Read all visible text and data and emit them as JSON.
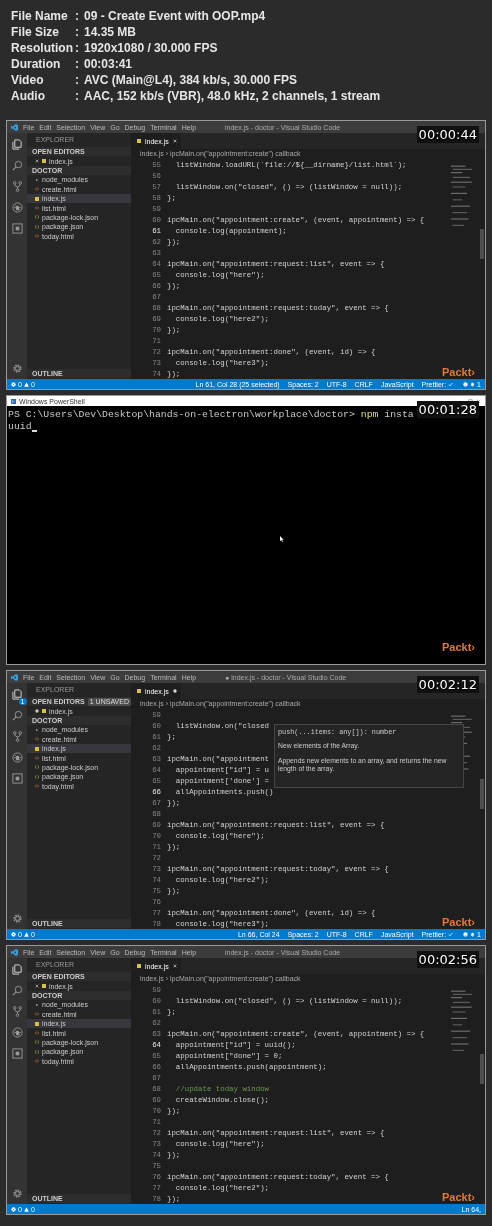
{
  "info": [
    {
      "label": "File Name",
      "sep": ":",
      "value": "09 - Create Event with OOP.mp4"
    },
    {
      "label": "File Size",
      "sep": ":",
      "value": "14.35 MB"
    },
    {
      "label": "Resolution",
      "sep": ":",
      "value": "1920x1080 / 30.000 FPS"
    },
    {
      "label": "Duration",
      "sep": ":",
      "value": "00:03:41"
    },
    {
      "label": "Video",
      "sep": ":",
      "value": "AVC (Main@L4), 384 kb/s, 30.000 FPS"
    },
    {
      "label": "Audio",
      "sep": ":",
      "value": "AAC, 152 kb/s (VBR), 48.0 kHz, 2 channels, 1 stream"
    }
  ],
  "frames": [
    {
      "kind": "vscode",
      "timestamp": "00:00:44",
      "logo": "Packt›",
      "menu": [
        "File",
        "Edit",
        "Selection",
        "View",
        "Go",
        "Debug",
        "Terminal",
        "Help"
      ],
      "title": "index.js - doctor - Visual Studio Code",
      "unsaved": false,
      "sidebar_title": "EXPLORER",
      "open_editors": "OPEN EDITORS",
      "open_file": "index.js",
      "folder": "DOCTOR",
      "outline": "OUTLINE",
      "files": [
        {
          "name": "node_modules",
          "kind": "folder",
          "selected": false
        },
        {
          "name": "create.html",
          "kind": "html",
          "selected": false
        },
        {
          "name": "index.js",
          "kind": "js",
          "selected": true
        },
        {
          "name": "list.html",
          "kind": "html",
          "selected": false
        },
        {
          "name": "package-lock.json",
          "kind": "json",
          "selected": false
        },
        {
          "name": "package.json",
          "kind": "json",
          "selected": false
        },
        {
          "name": "today.html",
          "kind": "html",
          "selected": false
        }
      ],
      "tab": "index.js",
      "breadcrumb": "index.js › ipcMain.on(\"appointment:create\") callback",
      "lines": [
        {
          "num": "55",
          "code": "  listWindow.loadURL(`file://${__dirname}/list.html`);",
          "kind": "code",
          "current": false
        },
        {
          "num": "56",
          "current": false
        },
        {
          "num": "57",
          "code": "  listWindow.on(\"closed\", () => (listWindow = null));",
          "kind": "code",
          "current": false
        },
        {
          "num": "58",
          "code": "};",
          "kind": "code",
          "current": false
        },
        {
          "num": "59",
          "current": false
        },
        {
          "num": "60",
          "code": "ipcMain.on(\"appointment:create\", (event, appointment) => {",
          "kind": "code",
          "current": false
        },
        {
          "num": "61",
          "code": "  console.log(appointment);",
          "kind": "code",
          "current": true
        },
        {
          "num": "62",
          "code": "});",
          "kind": "code",
          "current": false
        },
        {
          "num": "63",
          "current": false
        },
        {
          "num": "64",
          "code": "ipcMain.on(\"appointment:request:list\", event => {",
          "kind": "code",
          "current": false
        },
        {
          "num": "65",
          "code": "  console.log(\"here\");",
          "kind": "code",
          "current": false
        },
        {
          "num": "66",
          "code": "});",
          "kind": "code",
          "current": false
        },
        {
          "num": "67",
          "current": false
        },
        {
          "num": "68",
          "code": "ipcMain.on(\"appointment:request:today\", event => {",
          "kind": "code",
          "current": false
        },
        {
          "num": "69",
          "code": "  console.log(\"here2\");",
          "kind": "code",
          "current": false
        },
        {
          "num": "70",
          "code": "});",
          "kind": "code",
          "current": false
        },
        {
          "num": "71",
          "current": false
        },
        {
          "num": "72",
          "code": "ipcMain.on(\"appointment:done\", (event, id) => {",
          "kind": "code",
          "current": false
        },
        {
          "num": "73",
          "code": "  console.log(\"here3\");",
          "kind": "code",
          "current": false
        },
        {
          "num": "74",
          "code": "});",
          "kind": "code",
          "current": false
        }
      ],
      "errors": "0",
      "warnings": "0",
      "status": [
        "Ln 61, Col 28 (25 selected)",
        "Spaces: 2",
        "UTF-8",
        "CRLF",
        "JavaScript",
        "Prettier:"
      ],
      "bell": "1"
    },
    {
      "kind": "terminal",
      "timestamp": "00:01:28",
      "logo": "Packt›",
      "title": "Windows PowerShell",
      "lines": [
        {
          "cursor": false,
          "segments": [
            {
              "text": "PS C:\\Users\\Dev\\Desktop\\hands-on-electron\\workplace\\doctor> ",
              "kind": "plain"
            },
            {
              "text": "npm",
              "kind": "command"
            },
            {
              "text": " insta",
              "kind": "plain"
            }
          ]
        },
        {
          "cursor": true,
          "segments": [
            {
              "text": "uuid",
              "kind": "plain"
            }
          ]
        }
      ]
    },
    {
      "kind": "vscode",
      "timestamp": "00:02:12",
      "logo": "Packt›",
      "menu": [
        "File",
        "Edit",
        "Selection",
        "View",
        "Go",
        "Debug",
        "Terminal",
        "Help"
      ],
      "title": "● index.js - doctor - Visual Studio Code",
      "unsaved": true,
      "explorer_badge": "1",
      "sidebar_title": "EXPLORER",
      "open_editors": "OPEN EDITORS",
      "open_editors_badge": "1 UNSAVED",
      "open_file": "index.js",
      "folder": "DOCTOR",
      "outline": "OUTLINE",
      "files": [
        {
          "name": "node_modules",
          "kind": "folder",
          "selected": false
        },
        {
          "name": "create.html",
          "kind": "html",
          "selected": false
        },
        {
          "name": "index.js",
          "kind": "js",
          "selected": true
        },
        {
          "name": "list.html",
          "kind": "html",
          "selected": false
        },
        {
          "name": "package-lock.json",
          "kind": "json",
          "selected": false
        },
        {
          "name": "package.json",
          "kind": "json",
          "selected": false
        },
        {
          "name": "today.html",
          "kind": "html",
          "selected": false
        }
      ],
      "tab": "index.js",
      "breadcrumb": "index.js › ipcMain.on(\"appointment:create\") callback",
      "lines": [
        {
          "num": "59",
          "current": false
        },
        {
          "num": "60",
          "code": "  listWindow.on(\"closed",
          "kind": "code",
          "current": false
        },
        {
          "num": "61",
          "code": "};",
          "kind": "code",
          "current": false
        },
        {
          "num": "62",
          "current": false
        },
        {
          "num": "63",
          "code": "ipcMain.on(\"appointment",
          "kind": "code",
          "current": false
        },
        {
          "num": "64",
          "code": "  appointment[\"id\"] = u",
          "kind": "code",
          "current": false
        },
        {
          "num": "65",
          "code": "  appointment['done'] =",
          "kind": "code",
          "current": false
        },
        {
          "num": "66",
          "code": "  allAppointments.push()",
          "kind": "code",
          "current": true
        },
        {
          "num": "67",
          "code": "});",
          "kind": "code",
          "current": false
        },
        {
          "num": "68",
          "current": false
        },
        {
          "num": "69",
          "code": "ipcMain.on(\"appointment:request:list\", event => {",
          "kind": "code",
          "current": false
        },
        {
          "num": "70",
          "code": "  console.log(\"here\");",
          "kind": "code",
          "current": false
        },
        {
          "num": "71",
          "code": "});",
          "kind": "code",
          "current": false
        },
        {
          "num": "72",
          "current": false
        },
        {
          "num": "73",
          "code": "ipcMain.on(\"appointment:request:today\", event => {",
          "kind": "code",
          "current": false
        },
        {
          "num": "74",
          "code": "  console.log(\"here2\");",
          "kind": "code",
          "current": false
        },
        {
          "num": "75",
          "code": "});",
          "kind": "code",
          "current": false
        },
        {
          "num": "76",
          "current": false
        },
        {
          "num": "77",
          "code": "ipcMain.on(\"appointment:done\", (event, id) => {",
          "kind": "code",
          "current": false
        },
        {
          "num": "78",
          "code": "  console.log(\"here3\");",
          "kind": "code",
          "current": false
        }
      ],
      "tooltip": {
        "signature": "push(...items: any[]): number",
        "param": "New elements of the Array.",
        "doc": "Appends new elements to an array, and returns the new length of the array."
      },
      "errors": "0",
      "warnings": "0",
      "status": [
        "Ln 66, Col 24",
        "Spaces: 2",
        "UTF-8",
        "CRLF",
        "JavaScript",
        "Prettier:"
      ],
      "bell": "1"
    },
    {
      "kind": "vscode",
      "timestamp": "00:02:56",
      "logo": "Packt›",
      "menu": [
        "File",
        "Edit",
        "Selection",
        "View",
        "Go",
        "Debug",
        "Terminal",
        "Help"
      ],
      "title": "index.js - doctor - Visual Studio Code",
      "unsaved": false,
      "sidebar_title": "EXPLORER",
      "open_editors": "OPEN EDITORS",
      "open_file": "index.js",
      "folder": "DOCTOR",
      "outline": "OUTLINE",
      "files": [
        {
          "name": "node_modules",
          "kind": "folder",
          "selected": false
        },
        {
          "name": "create.html",
          "kind": "html",
          "selected": false
        },
        {
          "name": "index.js",
          "kind": "js",
          "selected": true
        },
        {
          "name": "list.html",
          "kind": "html",
          "selected": false
        },
        {
          "name": "package-lock.json",
          "kind": "json",
          "selected": false
        },
        {
          "name": "package.json",
          "kind": "json",
          "selected": false
        },
        {
          "name": "today.html",
          "kind": "html",
          "selected": false
        }
      ],
      "tab": "index.js",
      "breadcrumb": "index.js › ipcMain.on(\"appointment:create\") callback",
      "lines": [
        {
          "num": "59",
          "current": false
        },
        {
          "num": "60",
          "code": "  listWindow.on(\"closed\", () => (listWindow = null));",
          "kind": "code",
          "current": false
        },
        {
          "num": "61",
          "code": "};",
          "kind": "code",
          "current": false
        },
        {
          "num": "62",
          "current": false
        },
        {
          "num": "63",
          "code": "ipcMain.on(\"appointment:create\", (event, appointment) => {",
          "kind": "code",
          "current": false
        },
        {
          "num": "64",
          "code": "  appointment[\"id\"] = uuid();",
          "kind": "code",
          "current": true
        },
        {
          "num": "65",
          "code": "  appointment[\"done\"] = 0;",
          "kind": "code",
          "current": false
        },
        {
          "num": "66",
          "code": "  allAppointments.push(appointment);",
          "kind": "code",
          "current": false
        },
        {
          "num": "67",
          "current": false
        },
        {
          "num": "68",
          "code": "  //update today window",
          "kind": "comment",
          "current": false
        },
        {
          "num": "69",
          "code": "  createWindow.close();",
          "kind": "code",
          "current": false
        },
        {
          "num": "70",
          "code": "});",
          "kind": "code",
          "current": false
        },
        {
          "num": "71",
          "current": false
        },
        {
          "num": "72",
          "code": "ipcMain.on(\"appointment:request:list\", event => {",
          "kind": "code",
          "current": false
        },
        {
          "num": "73",
          "code": "  console.log(\"here\");",
          "kind": "code",
          "current": false
        },
        {
          "num": "74",
          "code": "});",
          "kind": "code",
          "current": false
        },
        {
          "num": "75",
          "current": false
        },
        {
          "num": "76",
          "code": "ipcMain.on(\"appointment:request:today\", event => {",
          "kind": "code",
          "current": false
        },
        {
          "num": "77",
          "code": "  console.log(\"here2\");",
          "kind": "code",
          "current": false
        },
        {
          "num": "78",
          "code": "});",
          "kind": "code",
          "current": false
        }
      ],
      "errors": "0",
      "warnings": "0",
      "status": [
        "Ln 64,"
      ]
    }
  ]
}
